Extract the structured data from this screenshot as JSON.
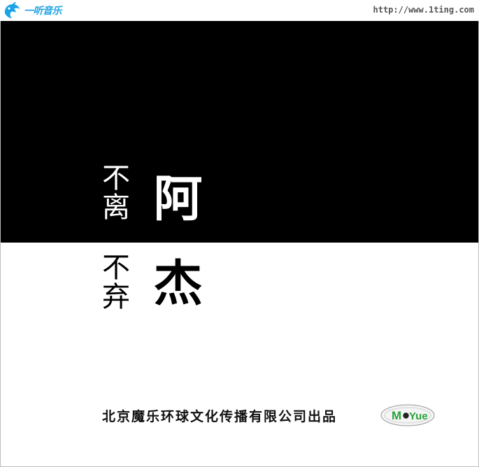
{
  "header": {
    "site_name": "一听音乐",
    "site_url": "http://www.1ting.com"
  },
  "cover": {
    "subtitle_top": "不离",
    "subtitle_bottom": "不弃",
    "artist_top": "阿",
    "artist_bottom": "杰",
    "publisher": "北京魔乐环球文化传播有限公司出品",
    "label_logo_text": "MoYue"
  },
  "colors": {
    "brand_blue": "#1aa3e6",
    "label_green": "#2aa33b"
  },
  "icons": {
    "site_logo": "dolphin-icon",
    "label_logo": "moyue-logo"
  }
}
